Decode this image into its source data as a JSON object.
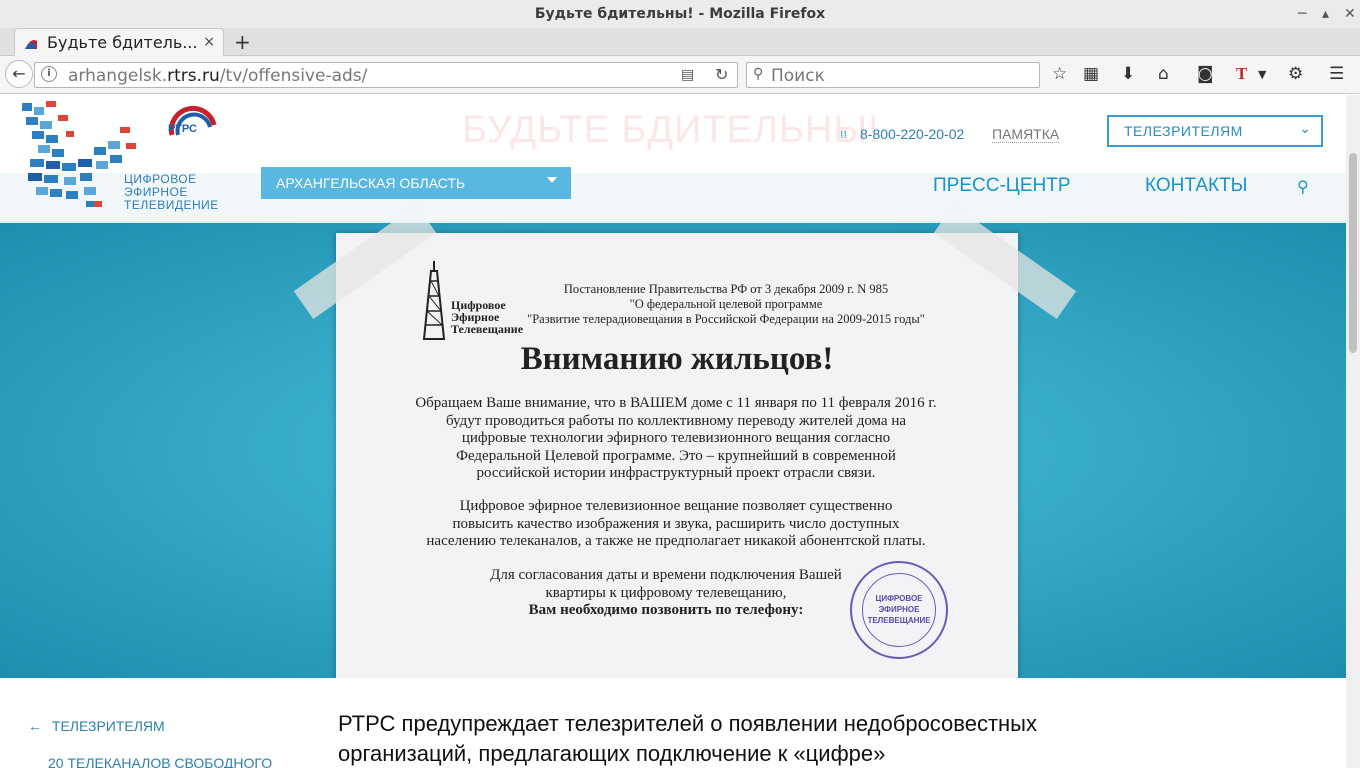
{
  "window": {
    "title": "Будьте бдительны! - Mozilla Firefox"
  },
  "tab": {
    "title": "Будьте бдитель...",
    "close_glyph": "×",
    "new_glyph": "+"
  },
  "url": {
    "host_prefix": "arhangelsk.",
    "host_main": "rtrs.ru",
    "path": "/tv/offensive-ads/"
  },
  "search": {
    "placeholder": "Поиск"
  },
  "header": {
    "ghost_title": "БУДЬТЕ БДИТЕЛЬНЫ!",
    "phone": "8-800-220-20-02",
    "memo": "ПАМЯТКА",
    "viewers_select": "ТЕЛЕЗРИТЕЛЯМ",
    "region_select": "АРХАНГЕЛЬСКАЯ ОБЛАСТЬ",
    "nav": [
      "ПРЕСС-ЦЕНТР",
      "КОНТАКТЫ"
    ],
    "logo_lines": [
      "ЦИФРОВОЕ",
      "ЭФИРНОЕ",
      "ТЕЛЕВИДЕНИЕ"
    ],
    "rtrs_logo": "РТРС"
  },
  "notice": {
    "brand_lines": [
      "Цифровое",
      "Эфирное",
      "Телевещание"
    ],
    "decree_lines": [
      "Постановление Правительства РФ от 3 декабря 2009 г. N 985",
      "\"О федеральной целевой программе",
      "\"Развитие телерадиовещания в Российской Федерации на 2009-2015 годы\""
    ],
    "heading": "Вниманию жильцов!",
    "para1": [
      "Обращаем Ваше внимание, что в ВАШЕМ доме с 11 января по 11 февраля 2016 г.",
      "будут проводиться работы по коллективному переводу жителей дома на",
      "цифровые технологии эфирного телевизионного вещания согласно",
      "Федеральной Целевой программе. Это – крупнейший в современной",
      "российской истории инфраструктурный проект отрасли связи."
    ],
    "para2": [
      "Цифровое эфирное телевизионное вещание позволяет существенно",
      "повысить качество изображения и звука, расширить число доступных",
      "населению телеканалов, а также не предполагает никакой абонентской платы."
    ],
    "para3": [
      "Для согласования даты и времени подключения Вашей",
      "квартиры к цифровому телевещанию,",
      "Вам необходимо позвонить по телефону:"
    ],
    "stamp_lines": [
      "ЦИФРОВОЕ",
      "ЭФИРНОЕ",
      "ТЕЛЕВЕЩАНИЕ"
    ]
  },
  "sidebar": {
    "back_label": "ТЕЛЕЗРИТЕЛЯМ",
    "next_label": "20 ТЕЛЕКАНАЛОВ СВОБОДНОГО"
  },
  "article": {
    "title": "РТРС предупреждает телезрителей о появлении недобросовестных организаций, предлагающих подключение к «цифре»"
  }
}
